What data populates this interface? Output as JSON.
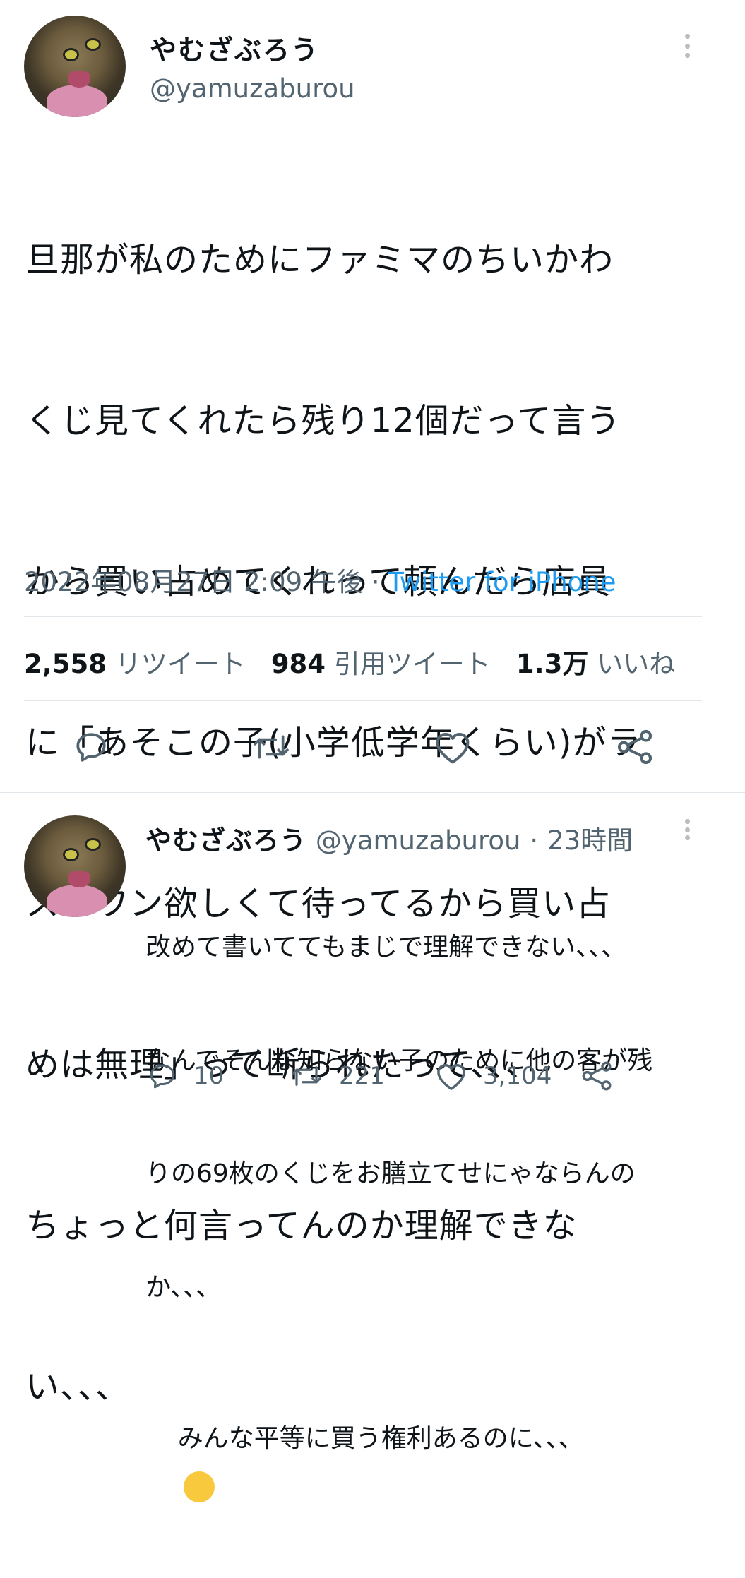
{
  "main_tweet": {
    "display_name": "やむざぶろう",
    "handle": "@yamuzaburou",
    "lines": [
      "旦那が私のためにファミマのちいかわ",
      "くじ見てくれたら残り12個だって言う",
      "から買い占めてくれって頼んだら店員",
      "に「あそこの子(小学低学年くらい)がラ",
      "ストワン欲しくて待ってるから買い占",
      "めは無理」って断られたって、、、",
      "ちょっと何言ってんのか理解できな",
      "い、、、"
    ],
    "timestamp": "2022年08月27日 2:09 午後",
    "separator": "·",
    "source": "Twitter for iPhone",
    "stats": {
      "retweets_count": "2,558",
      "retweets_label": "リツイート",
      "quotes_count": "984",
      "quotes_label": "引用ツイート",
      "likes_count": "1.3万",
      "likes_label": "いいね"
    }
  },
  "reply_tweet": {
    "display_name": "やむざぶろう",
    "handle": "@yamuzaburou",
    "separator": "·",
    "time_ago": "23時間",
    "lines": [
      "改めて書いててもまじで理解できない、、、",
      "なんでそんな知らない子のために他の客が残",
      "りの69枚のくじをお膳立てせにゃならんの",
      "か、、、",
      "みんな平等に買う権利あるのに、、、"
    ],
    "emoji": "😢",
    "reply_count": "10",
    "retweet_count": "221",
    "like_count": "3,104"
  },
  "icons": {
    "more": "more-vertical-icon",
    "reply": "reply-bubble-icon",
    "retweet": "retweet-icon",
    "like": "heart-icon",
    "share": "share-icon"
  },
  "colors": {
    "text": "#0f1419",
    "secondary": "#536471",
    "link": "#1d9bf0",
    "divider": "#e1e6ea",
    "icon": "#536471"
  }
}
